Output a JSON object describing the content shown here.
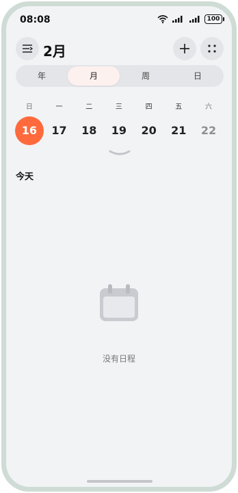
{
  "status": {
    "time": "08:08",
    "battery": "100"
  },
  "header": {
    "title": "2月"
  },
  "views": [
    "年",
    "月",
    "周",
    "日"
  ],
  "active_view": "月",
  "weekdays": [
    "日",
    "一",
    "二",
    "三",
    "四",
    "五",
    "六"
  ],
  "dates": [
    "16",
    "17",
    "18",
    "19",
    "20",
    "21",
    "22"
  ],
  "today_date": "16",
  "section": {
    "today": "今天"
  },
  "empty": {
    "message": "没有日程"
  },
  "colors": {
    "accent": "#ff6a3d",
    "background": "#f2f3f5"
  }
}
